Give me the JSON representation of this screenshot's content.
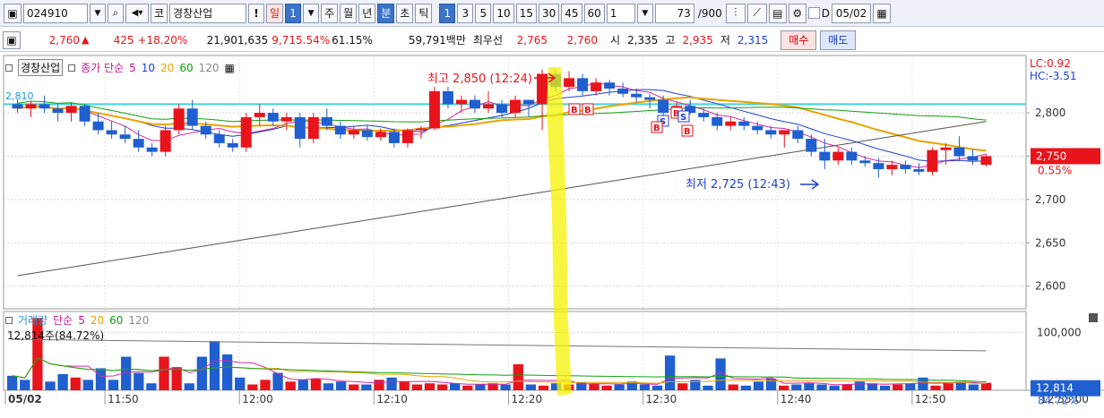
{
  "toolbar": {
    "code": "024910",
    "market": "코",
    "name": "경창산업",
    "bang": "!",
    "period_day": "일",
    "day_count": "1",
    "periods": [
      "주",
      "월",
      "년",
      "분",
      "초",
      "틱"
    ],
    "minutes": [
      "1",
      "3",
      "5",
      "10",
      "15",
      "30",
      "45",
      "60"
    ],
    "unit": "1",
    "count": "73",
    "count_total": "/900",
    "date_checkbox_label": "D",
    "date": "05/02"
  },
  "info": {
    "price": "2,760",
    "change_arrow": "▲",
    "change": "425",
    "change_pct": "+18.20%",
    "volume": "21,901,635",
    "volume_ratio": "9,715.54%",
    "turnover_pct": "61.15%",
    "amount": "59,791백만",
    "best_label": "최우선",
    "ask": "2,765",
    "bid": "2,760",
    "open_label": "시",
    "open": "2,335",
    "high_label": "고",
    "high": "2,935",
    "low_label": "저",
    "low": "2,315",
    "buy_btn": "매수",
    "sell_btn": "매도"
  },
  "legend": {
    "name": "경창산업",
    "price_label": "종가 단순",
    "ma": [
      "5",
      "10",
      "20",
      "60",
      "120"
    ],
    "ma_colors": [
      "#e8141c",
      "#1f3fd0",
      "#e8a300",
      "#11a011",
      "#555555"
    ]
  },
  "annotations": {
    "lc": "LC:0.92",
    "hc": "HC:-3.51",
    "high": "최고 2,850 (12:24)",
    "low": "최저 2,725 (12:43)",
    "current_price": "2,750",
    "current_pct": "0.55%",
    "left_ref": "2,810"
  },
  "vol_legend": {
    "title": "거래량",
    "ma_label": "단순",
    "ma": [
      "5",
      "20",
      "60",
      "120"
    ],
    "last": "12,814주(84.72%)",
    "current": "12,814",
    "current_pct": "84.72%"
  },
  "chart_data": {
    "type": "candlestick",
    "y_ticks": [
      "2,800",
      "2,750",
      "2,700",
      "2,650",
      "2,600"
    ],
    "y_tick_values": [
      2800,
      2750,
      2700,
      2650,
      2600
    ],
    "ylim": [
      2580,
      2860
    ],
    "vol_ticks": [
      "100,000"
    ],
    "vol_tick_values": [
      100000
    ],
    "vol_max": 130000,
    "x_labels": [
      "05/02",
      "11:50",
      "12:00",
      "12:10",
      "12:20",
      "12:30",
      "12:40",
      "12:50",
      "12:55:00"
    ],
    "x_label_bars": [
      0,
      7,
      17,
      27,
      37,
      47,
      57,
      67,
      null
    ],
    "candles": [
      [
        2810,
        2815,
        2800,
        2805
      ],
      [
        2805,
        2813,
        2795,
        2810
      ],
      [
        2810,
        2820,
        2800,
        2805
      ],
      [
        2805,
        2810,
        2790,
        2800
      ],
      [
        2800,
        2812,
        2790,
        2808
      ],
      [
        2808,
        2810,
        2785,
        2790
      ],
      [
        2790,
        2800,
        2775,
        2780
      ],
      [
        2780,
        2790,
        2770,
        2775
      ],
      [
        2775,
        2785,
        2765,
        2770
      ],
      [
        2770,
        2780,
        2755,
        2760
      ],
      [
        2760,
        2765,
        2750,
        2755
      ],
      [
        2755,
        2785,
        2750,
        2780
      ],
      [
        2780,
        2810,
        2775,
        2805
      ],
      [
        2805,
        2815,
        2780,
        2785
      ],
      [
        2785,
        2790,
        2770,
        2775
      ],
      [
        2775,
        2780,
        2760,
        2765
      ],
      [
        2765,
        2770,
        2755,
        2760
      ],
      [
        2760,
        2800,
        2755,
        2795
      ],
      [
        2795,
        2810,
        2785,
        2800
      ],
      [
        2800,
        2805,
        2785,
        2790
      ],
      [
        2790,
        2800,
        2780,
        2795
      ],
      [
        2795,
        2800,
        2760,
        2770
      ],
      [
        2770,
        2800,
        2765,
        2795
      ],
      [
        2795,
        2805,
        2780,
        2785
      ],
      [
        2785,
        2790,
        2770,
        2775
      ],
      [
        2775,
        2785,
        2770,
        2780
      ],
      [
        2780,
        2785,
        2768,
        2772
      ],
      [
        2772,
        2782,
        2768,
        2778
      ],
      [
        2778,
        2782,
        2760,
        2765
      ],
      [
        2765,
        2782,
        2760,
        2780
      ],
      [
        2780,
        2785,
        2770,
        2782
      ],
      [
        2782,
        2830,
        2780,
        2825
      ],
      [
        2825,
        2830,
        2805,
        2810
      ],
      [
        2810,
        2820,
        2800,
        2815
      ],
      [
        2815,
        2820,
        2800,
        2805
      ],
      [
        2805,
        2825,
        2800,
        2810
      ],
      [
        2810,
        2815,
        2795,
        2800
      ],
      [
        2800,
        2820,
        2795,
        2815
      ],
      [
        2815,
        2810,
        2795,
        2810
      ],
      [
        2810,
        2850,
        2780,
        2845
      ],
      [
        2845,
        2850,
        2825,
        2830
      ],
      [
        2830,
        2848,
        2825,
        2840
      ],
      [
        2840,
        2845,
        2820,
        2825
      ],
      [
        2825,
        2840,
        2820,
        2835
      ],
      [
        2835,
        2838,
        2820,
        2828
      ],
      [
        2828,
        2835,
        2818,
        2822
      ],
      [
        2822,
        2828,
        2812,
        2818
      ],
      [
        2818,
        2822,
        2805,
        2815
      ],
      [
        2815,
        2820,
        2795,
        2800
      ],
      [
        2800,
        2812,
        2795,
        2808
      ],
      [
        2808,
        2815,
        2798,
        2800
      ],
      [
        2800,
        2805,
        2790,
        2795
      ],
      [
        2795,
        2800,
        2780,
        2785
      ],
      [
        2785,
        2795,
        2780,
        2790
      ],
      [
        2790,
        2795,
        2780,
        2785
      ],
      [
        2785,
        2790,
        2775,
        2780
      ],
      [
        2780,
        2785,
        2770,
        2775
      ],
      [
        2775,
        2780,
        2760,
        2780
      ],
      [
        2780,
        2785,
        2765,
        2770
      ],
      [
        2770,
        2775,
        2750,
        2755
      ],
      [
        2755,
        2770,
        2735,
        2745
      ],
      [
        2745,
        2760,
        2740,
        2755
      ],
      [
        2755,
        2760,
        2740,
        2745
      ],
      [
        2745,
        2750,
        2738,
        2742
      ],
      [
        2742,
        2748,
        2725,
        2735
      ],
      [
        2735,
        2745,
        2728,
        2740
      ],
      [
        2740,
        2745,
        2730,
        2735
      ],
      [
        2735,
        2742,
        2728,
        2732
      ],
      [
        2732,
        2760,
        2728,
        2757
      ],
      [
        2757,
        2765,
        2740,
        2760
      ],
      [
        2760,
        2773,
        2745,
        2750
      ],
      [
        2750,
        2758,
        2740,
        2745
      ],
      [
        2740,
        2752,
        2738,
        2750
      ]
    ],
    "volumes": [
      25000,
      18000,
      125000,
      15000,
      28000,
      22000,
      18000,
      38000,
      18000,
      58000,
      30000,
      12000,
      58000,
      40000,
      12000,
      58000,
      85000,
      62000,
      22000,
      10000,
      18000,
      30000,
      15000,
      18000,
      20000,
      12000,
      15000,
      10000,
      10000,
      18000,
      22000,
      15000,
      10000,
      12000,
      10000,
      12000,
      8000,
      10000,
      12000,
      10000,
      45000,
      10000,
      8000,
      12000,
      10000,
      14000,
      12000,
      8000,
      10000,
      15000,
      10000,
      8000,
      60000,
      12000,
      18000,
      8000,
      55000,
      10000,
      8000,
      15000,
      20000,
      8000,
      10000,
      12000,
      10000,
      8000,
      10000,
      15000,
      12000,
      8000,
      10000,
      12000,
      22000,
      8000,
      12000,
      15000,
      10000,
      12814
    ]
  }
}
